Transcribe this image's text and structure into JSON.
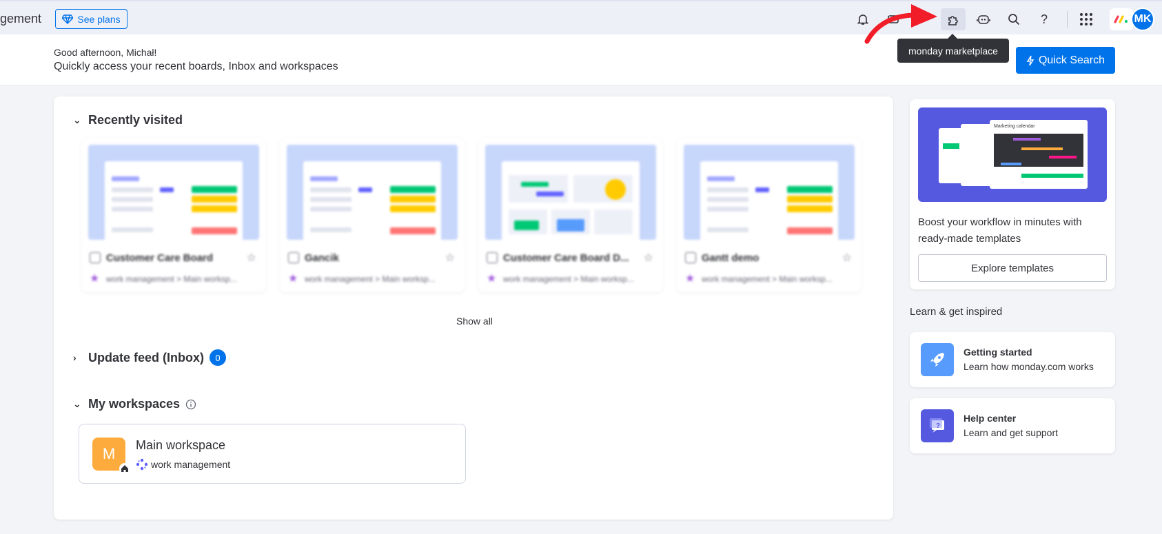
{
  "topbar": {
    "brand_text": "gement",
    "see_plans_label": "See plans",
    "avatar_initials": "MK"
  },
  "header": {
    "greeting": "Good afternoon, Michał!",
    "subtitle": "Quickly access your recent boards, Inbox and workspaces",
    "quick_search_label": "Quick Search"
  },
  "tooltip": {
    "text": "monday marketplace"
  },
  "recently_visited": {
    "title": "Recently visited",
    "boards": [
      {
        "name": "Customer Care Board",
        "path": "work management > Main worksp..."
      },
      {
        "name": "Gancik",
        "path": "work management > Main worksp..."
      },
      {
        "name": "Customer Care Board D...",
        "path": "work management > Main worksp..."
      },
      {
        "name": "Gantt demo",
        "path": "work management > Main worksp..."
      }
    ],
    "show_all": "Show all"
  },
  "update_feed": {
    "title": "Update feed (Inbox)",
    "count": "0"
  },
  "workspaces": {
    "title": "My workspaces",
    "main": {
      "letter": "M",
      "name": "Main workspace",
      "type": "work management"
    }
  },
  "templates": {
    "text": "Boost your workflow in minutes with ready-made templates",
    "button": "Explore templates",
    "preview_label": "Marketing calendar"
  },
  "learn": {
    "title": "Learn & get inspired",
    "items": [
      {
        "title": "Getting started",
        "subtitle": "Learn how monday.com works"
      },
      {
        "title": "Help center",
        "subtitle": "Learn and get support"
      }
    ]
  },
  "colors": {
    "accent": "#0073ea",
    "workspace": "#fdab3d",
    "rocket": "#579bfc",
    "help": "#5559df"
  }
}
